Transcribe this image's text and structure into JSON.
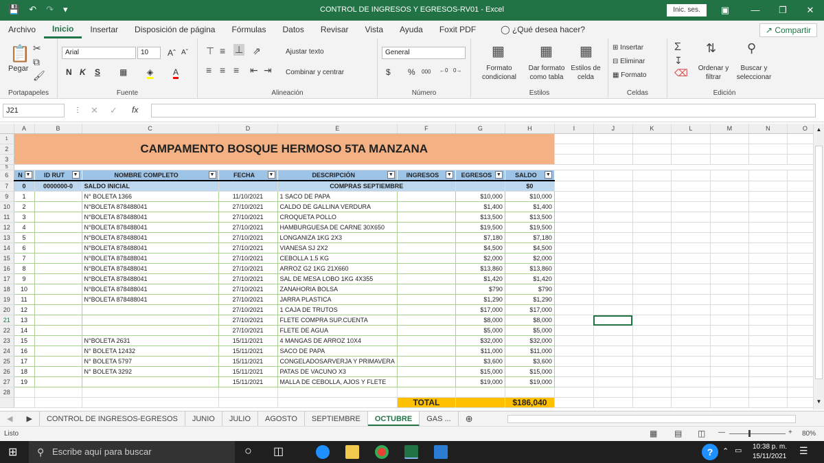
{
  "window": {
    "title": "CONTROL DE INGRESOS Y EGRESOS-RV01  -  Excel",
    "signin": "Inic. ses."
  },
  "menu": [
    "Archivo",
    "Inicio",
    "Insertar",
    "Disposición de página",
    "Fórmulas",
    "Datos",
    "Revisar",
    "Vista",
    "Ayuda",
    "Foxit PDF"
  ],
  "tell_me": "¿Qué desea hacer?",
  "share": "Compartir",
  "ribbon": {
    "paste": "Pegar",
    "font_name": "Arial",
    "font_size": "10",
    "wrap_text": "Ajustar texto",
    "merge_center": "Combinar y centrar",
    "number_format": "General",
    "cond_format": "Formato condicional",
    "format_table": "Dar formato como tabla",
    "cell_styles": "Estilos de celda",
    "insert": "Insertar",
    "delete": "Eliminar",
    "format": "Formato",
    "sort_filter": "Ordenar y filtrar",
    "find_select": "Buscar y seleccionar",
    "groups": [
      "Portapapeles",
      "Fuente",
      "Alineación",
      "Número",
      "Estilos",
      "Celdas",
      "Edición"
    ]
  },
  "formula_bar": {
    "name_box": "J21",
    "fx": "fx",
    "value": ""
  },
  "columns": [
    "A",
    "B",
    "C",
    "D",
    "E",
    "F",
    "G",
    "H",
    "I",
    "J",
    "K",
    "L",
    "M",
    "N",
    "O"
  ],
  "sheet": {
    "title": "CAMPAMENTO BOSQUE HERMOSO 5TA MANZANA",
    "headers": [
      "N",
      "ID RUT",
      "NOMBRE COMPLETO",
      "FECHA",
      "DESCRIPCIÓN",
      "INGRESOS",
      "EGRESOS",
      "SALDO"
    ],
    "row7": {
      "n": "0",
      "rut": "0000000-0",
      "name": "SALDO INICIAL",
      "desc": "COMPRAS SEPTIEMBRE",
      "saldo": "$0"
    },
    "rows": [
      {
        "r": "9",
        "n": "1",
        "name": "N° BOLETA 1366",
        "date": "11/10/2021",
        "desc": "1 SACO DE PAPA",
        "egr": "$10,000",
        "saldo": "$10,000"
      },
      {
        "r": "10",
        "n": "2",
        "name": "N°BOLETA 878488041",
        "date": "27/10/2021",
        "desc": "CALDO DE GALLINA VERDURA",
        "egr": "$1,400",
        "saldo": "$1,400"
      },
      {
        "r": "11",
        "n": "3",
        "name": "N°BOLETA 878488041",
        "date": "27/10/2021",
        "desc": "CROQUETA POLLO",
        "egr": "$13,500",
        "saldo": "$13,500"
      },
      {
        "r": "12",
        "n": "4",
        "name": "N°BOLETA 878488041",
        "date": "27/10/2021",
        "desc": "HAMBURGUESA DE CARNE 30X650",
        "egr": "$19,500",
        "saldo": "$19,500"
      },
      {
        "r": "13",
        "n": "5",
        "name": "N°BOLETA 878488041",
        "date": "27/10/2021",
        "desc": "LONGANIZA 1KG 2X3",
        "egr": "$7,180",
        "saldo": "$7,180"
      },
      {
        "r": "14",
        "n": "6",
        "name": "N°BOLETA 878488041",
        "date": "27/10/2021",
        "desc": "VIANESA SJ 2X2",
        "egr": "$4,500",
        "saldo": "$4,500"
      },
      {
        "r": "15",
        "n": "7",
        "name": "N°BOLETA 878488041",
        "date": "27/10/2021",
        "desc": "CEBOLLA 1.5 KG",
        "egr": "$2,000",
        "saldo": "$2,000"
      },
      {
        "r": "16",
        "n": "8",
        "name": "N°BOLETA 878488041",
        "date": "27/10/2021",
        "desc": "ARROZ G2 1KG 21X660",
        "egr": "$13,860",
        "saldo": "$13,860"
      },
      {
        "r": "17",
        "n": "9",
        "name": "N°BOLETA 878488041",
        "date": "27/10/2021",
        "desc": "SAL DE MESA LOBO 1KG 4X355",
        "egr": "$1,420",
        "saldo": "$1,420"
      },
      {
        "r": "18",
        "n": "10",
        "name": "N°BOLETA 878488041",
        "date": "27/10/2021",
        "desc": "ZANAHORIA BOLSA",
        "egr": "$790",
        "saldo": "$790"
      },
      {
        "r": "19",
        "n": "11",
        "name": "N°BOLETA 878488041",
        "date": "27/10/2021",
        "desc": "JARRA PLASTICA",
        "egr": "$1,290",
        "saldo": "$1,290"
      },
      {
        "r": "20",
        "n": "12",
        "name": "",
        "date": "27/10/2021",
        "desc": "1 CAJA DE TRUTOS",
        "egr": "$17,000",
        "saldo": "$17,000"
      },
      {
        "r": "21",
        "n": "13",
        "name": "",
        "date": "27/10/2021",
        "desc": "FLETE COMPRA SUP.CUENTA",
        "egr": "$8,000",
        "saldo": "$8,000"
      },
      {
        "r": "22",
        "n": "14",
        "name": "",
        "date": "27/10/2021",
        "desc": "FLETE DE AGUA",
        "egr": "$5,000",
        "saldo": "$5,000"
      },
      {
        "r": "23",
        "n": "15",
        "name": "N°BOLETA 2631",
        "date": "15/11/2021",
        "desc": "4 MANGAS DE ARROZ 10X4",
        "egr": "$32,000",
        "saldo": "$32,000"
      },
      {
        "r": "24",
        "n": "16",
        "name": "N° BOLETA 12432",
        "date": "15/11/2021",
        "desc": "SACO DE PAPA",
        "egr": "$11,000",
        "saldo": "$11,000"
      },
      {
        "r": "25",
        "n": "17",
        "name": "N° BOLETA 5797",
        "date": "15/11/2021",
        "desc": " CONGELADOSARVERJA Y PRIMAVERA",
        "egr": "$3,600",
        "saldo": "$3,600"
      },
      {
        "r": "26",
        "n": "18",
        "name": "N° BOLETA 3292",
        "date": "15/11/2021",
        "desc": "PATAS DE VACUNO X3",
        "egr": "$15,000",
        "saldo": "$15,000"
      },
      {
        "r": "27",
        "n": "19",
        "name": "",
        "date": "15/11/2021",
        "desc": "MALLA DE CEBOLLA, AJOS Y  FLETE",
        "egr": "$19,000",
        "saldo": "$19,000"
      }
    ],
    "total_label": "TOTAL",
    "total_value": "$186,040"
  },
  "tabs": [
    "CONTROL DE INGRESOS-EGRESOS",
    "JUNIO",
    "JULIO",
    "AGOSTO",
    "SEPTIEMBRE",
    "OCTUBRE",
    "GAS ..."
  ],
  "status": {
    "ready": "Listo",
    "zoom": "80%"
  },
  "taskbar": {
    "search": "Escribe aquí para buscar",
    "time": "10:38 p. m.",
    "date": "15/11/2021"
  },
  "colors": {
    "excel_green": "#217346",
    "title_fill": "#f4b183",
    "header_fill": "#9dc3e6",
    "total_fill": "#ffc000"
  }
}
